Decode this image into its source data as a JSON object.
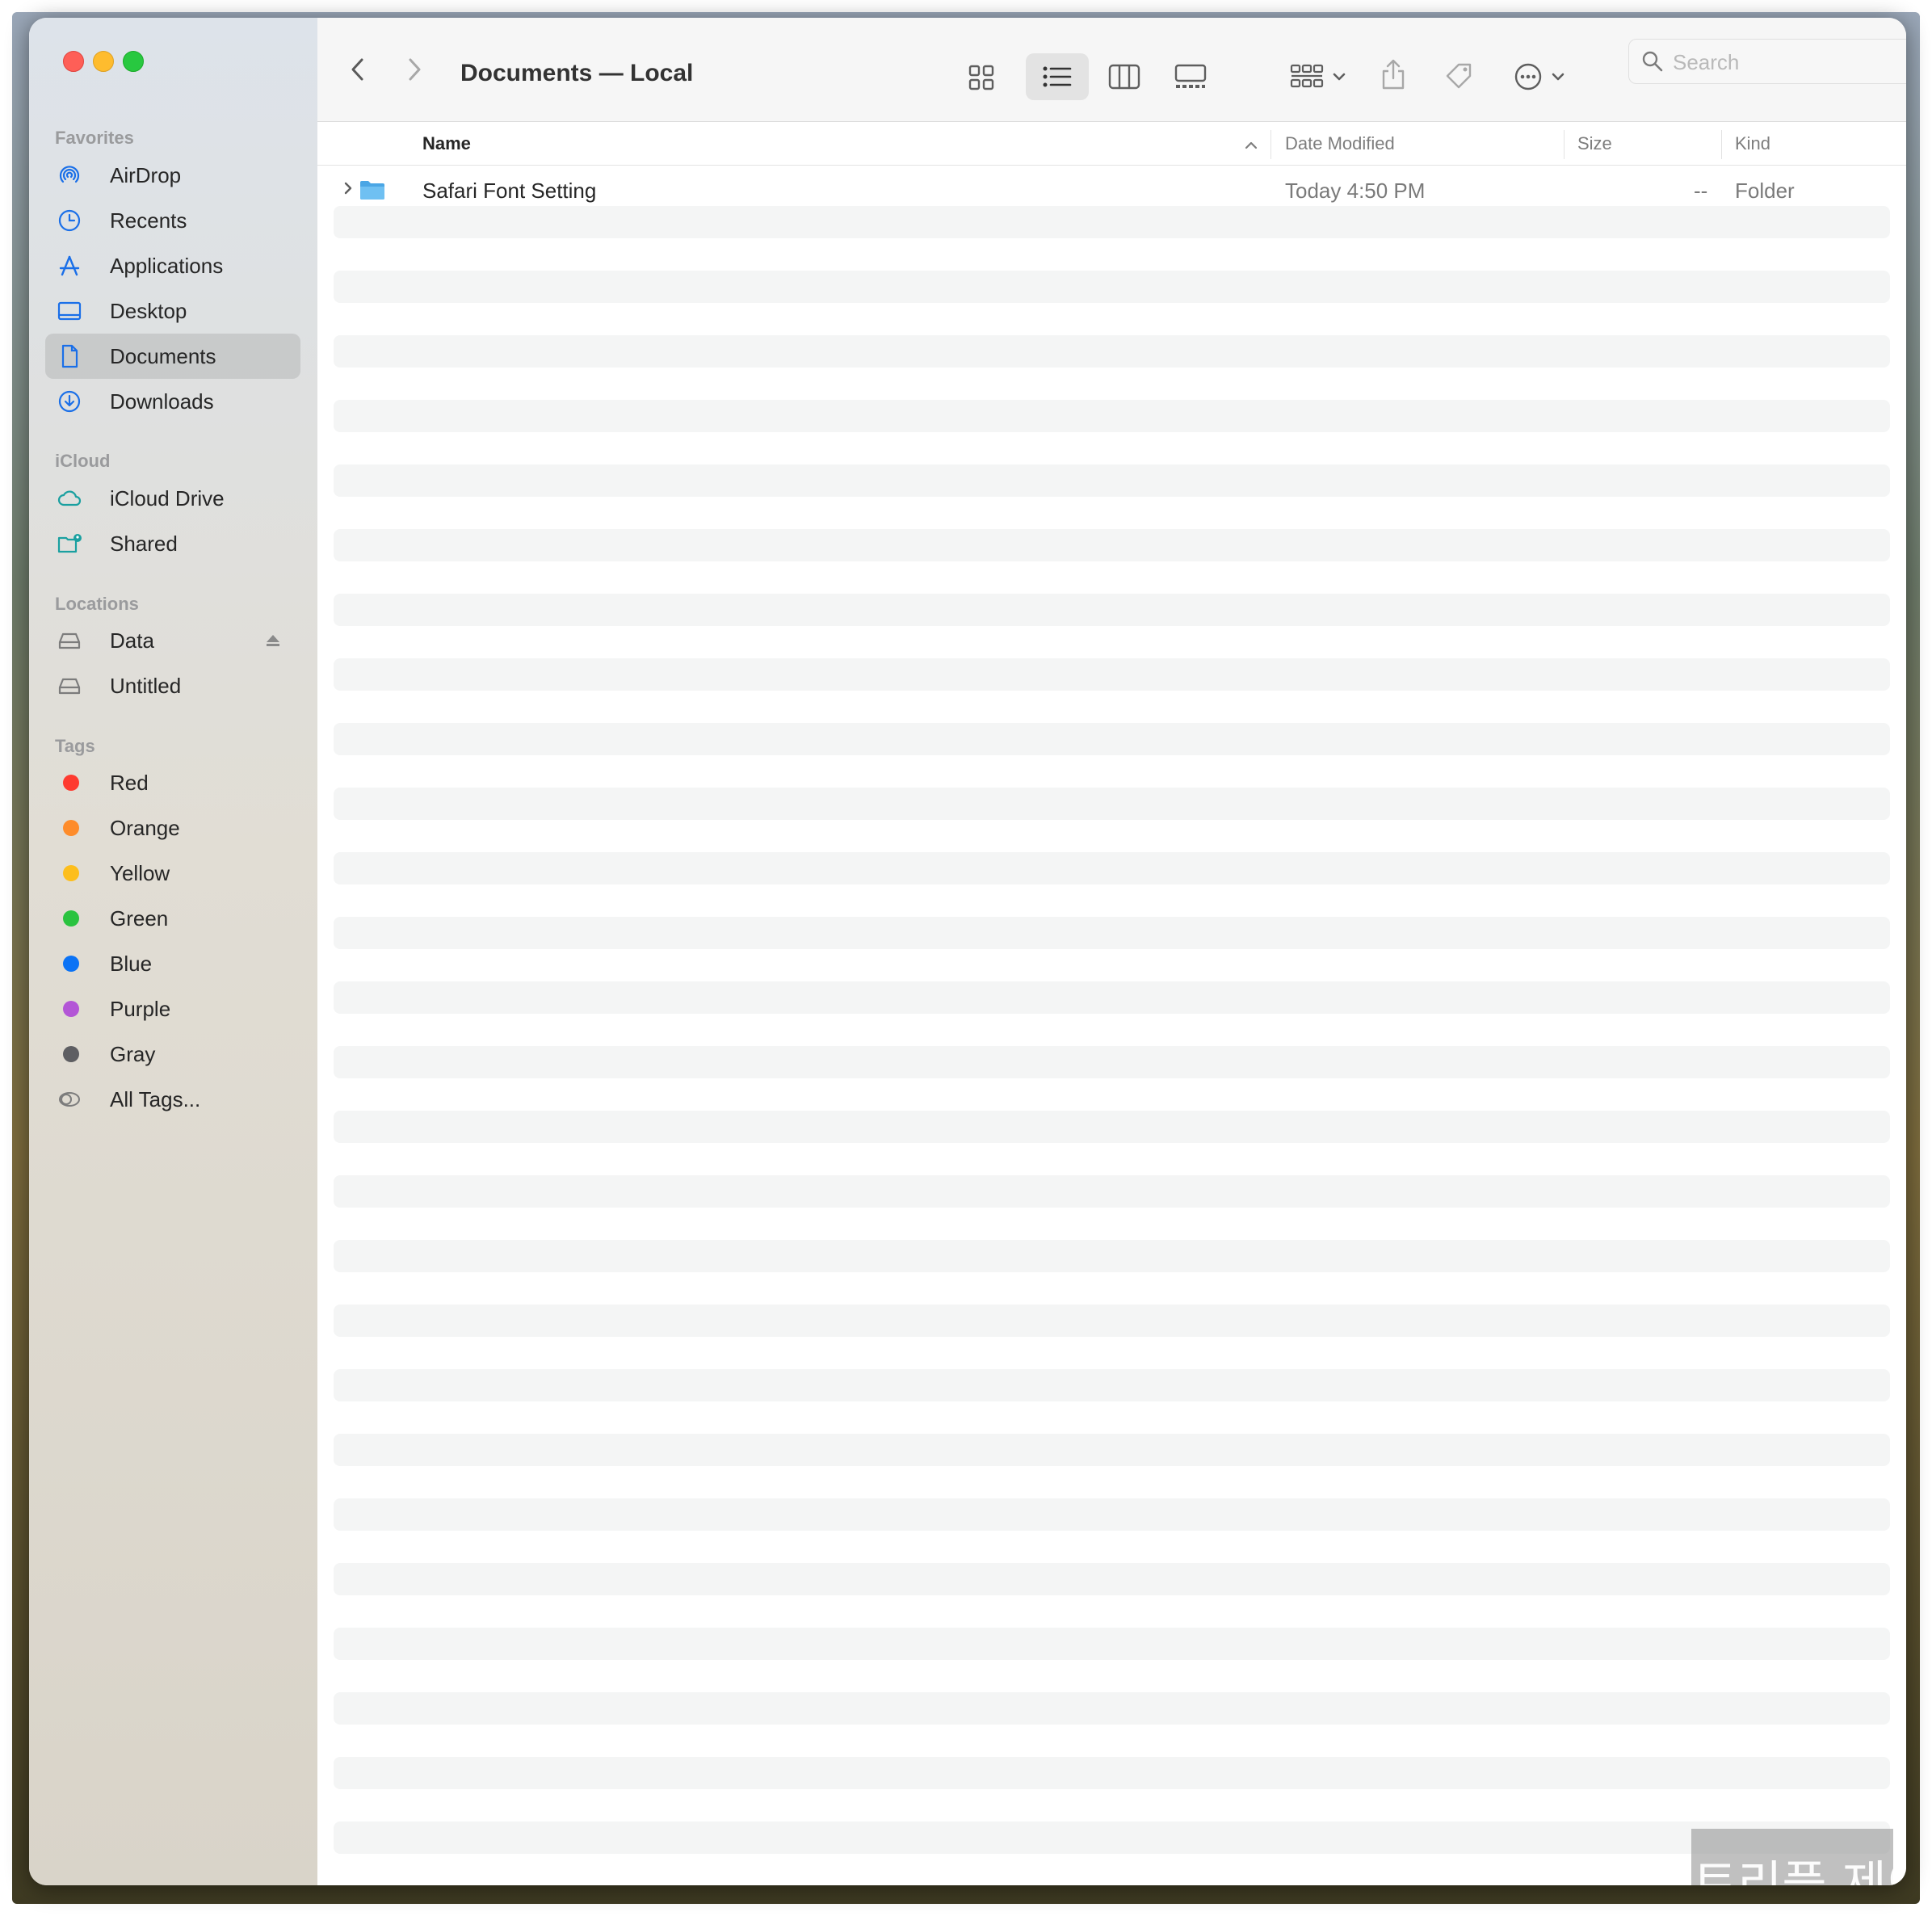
{
  "window": {
    "title": "Documents — Local"
  },
  "sidebar": {
    "favorites_header": "Favorites",
    "favorites": [
      {
        "label": "AirDrop",
        "icon": "airdrop-icon"
      },
      {
        "label": "Recents",
        "icon": "clock-icon"
      },
      {
        "label": "Applications",
        "icon": "applications-icon"
      },
      {
        "label": "Desktop",
        "icon": "desktop-icon"
      },
      {
        "label": "Documents",
        "icon": "document-icon",
        "selected": true
      },
      {
        "label": "Downloads",
        "icon": "download-icon"
      }
    ],
    "icloud_header": "iCloud",
    "icloud": [
      {
        "label": "iCloud Drive",
        "icon": "cloud-icon"
      },
      {
        "label": "Shared",
        "icon": "shared-folder-icon"
      }
    ],
    "locations_header": "Locations",
    "locations": [
      {
        "label": "Data",
        "icon": "disk-icon",
        "ejectable": true
      },
      {
        "label": "Untitled",
        "icon": "disk-icon"
      }
    ],
    "tags_header": "Tags",
    "tags": [
      {
        "label": "Red",
        "color": "#fe3b30"
      },
      {
        "label": "Orange",
        "color": "#fe8c2b"
      },
      {
        "label": "Yellow",
        "color": "#fdbe1c"
      },
      {
        "label": "Green",
        "color": "#2ac33f"
      },
      {
        "label": "Blue",
        "color": "#0b73f5"
      },
      {
        "label": "Purple",
        "color": "#b356d6"
      },
      {
        "label": "Gray",
        "color": "#8d8d91"
      },
      {
        "label": "All Tags...",
        "icon": "all-tags-icon"
      }
    ]
  },
  "toolbar": {
    "search_placeholder": "Search"
  },
  "columns": {
    "name": "Name",
    "date_modified": "Date Modified",
    "size": "Size",
    "kind": "Kind"
  },
  "files": [
    {
      "name": "Safari Font Setting",
      "date_modified": "Today 4:50 PM",
      "size": "--",
      "kind": "Folder"
    }
  ],
  "watermark": "트리플 제이",
  "colors": {
    "accent": "#1a6fe8",
    "selection": "#cfcfd2",
    "folder": "#5ab0e8"
  }
}
